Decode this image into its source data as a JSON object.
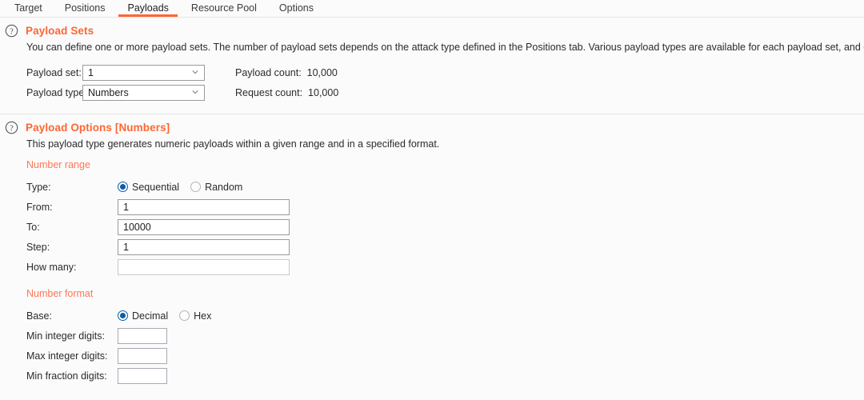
{
  "tabs": [
    {
      "label": "Target",
      "active": false
    },
    {
      "label": "Positions",
      "active": false
    },
    {
      "label": "Payloads",
      "active": true
    },
    {
      "label": "Resource Pool",
      "active": false
    },
    {
      "label": "Options",
      "active": false
    }
  ],
  "payload_sets": {
    "icon": "help-circle-icon",
    "title": "Payload Sets",
    "description": "You can define one or more payload sets. The number of payload sets depends on the attack type defined in the Positions tab. Various payload types are available for each payload set, and each payload",
    "payload_set_label": "Payload set:",
    "payload_set_value": "1",
    "payload_type_label": "Payload type:",
    "payload_type_value": "Numbers",
    "payload_count_label": "Payload count:",
    "payload_count_value": "10,000",
    "request_count_label": "Request count:",
    "request_count_value": "10,000"
  },
  "payload_options": {
    "icon": "help-circle-icon",
    "title": "Payload Options [Numbers]",
    "description": "This payload type generates numeric payloads within a given range and in a specified format.",
    "number_range": {
      "heading": "Number range",
      "type_label": "Type:",
      "type_options": [
        {
          "label": "Sequential",
          "checked": true
        },
        {
          "label": "Random",
          "checked": false
        }
      ],
      "from_label": "From:",
      "from_value": "1",
      "to_label": "To:",
      "to_value": "10000",
      "step_label": "Step:",
      "step_value": "1",
      "how_many_label": "How many:",
      "how_many_value": ""
    },
    "number_format": {
      "heading": "Number format",
      "base_label": "Base:",
      "base_options": [
        {
          "label": "Decimal",
          "checked": true
        },
        {
          "label": "Hex",
          "checked": false
        }
      ],
      "min_integer_label": "Min integer digits:",
      "min_integer_value": "",
      "max_integer_label": "Max integer digits:",
      "max_integer_value": "",
      "min_fraction_label": "Min fraction digits:",
      "min_fraction_value": ""
    }
  },
  "colors": {
    "accent": "#ff6633",
    "subheading": "#ff7755",
    "radio_selected": "#0b5ea8",
    "background": "#fbfbfb"
  }
}
